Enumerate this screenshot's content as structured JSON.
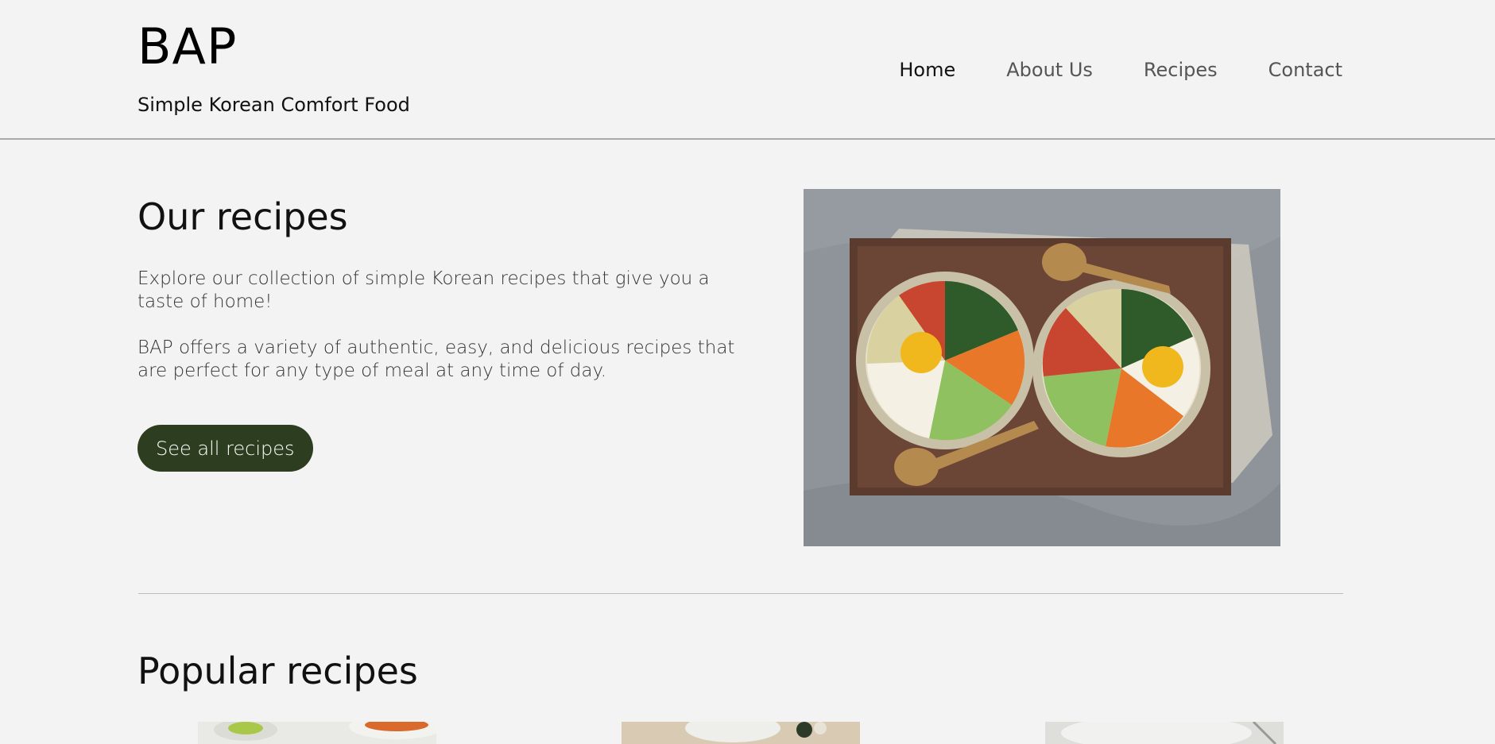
{
  "header": {
    "logo": "BAP",
    "tagline": "Simple Korean Comfort Food",
    "nav": [
      {
        "label": "Home",
        "active": true
      },
      {
        "label": "About Us",
        "active": false
      },
      {
        "label": "Recipes",
        "active": false
      },
      {
        "label": "Contact",
        "active": false
      }
    ]
  },
  "hero": {
    "title": "Our recipes",
    "paragraphs": [
      "Explore our collection of simple Korean recipes that give you a taste of home!",
      "BAP offers a variety of authentic, easy, and delicious recipes that are perfect for any type of meal at any time of day."
    ],
    "cta_label": "See all recipes",
    "image_subject": "two bibimbap bowls on a wooden tray"
  },
  "popular": {
    "title": "Popular recipes"
  },
  "colors": {
    "background": "#f3f3f3",
    "accent": "#2c3e1f"
  }
}
